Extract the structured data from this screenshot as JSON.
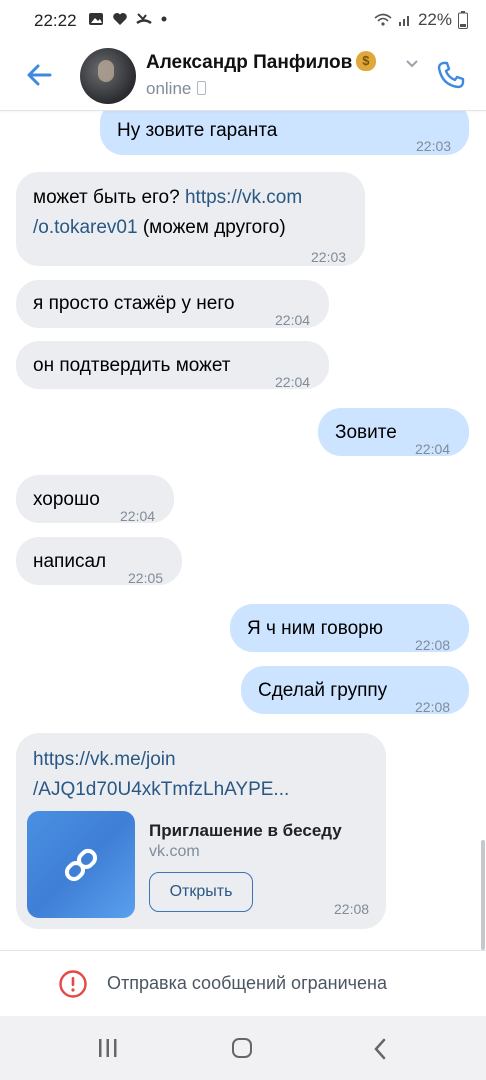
{
  "status_bar": {
    "time": "22:22",
    "battery": "22%"
  },
  "header": {
    "name": "Александр Панфилов",
    "status": "online"
  },
  "messages": [
    {
      "text": "Ну зовите гаранта",
      "time": "22:03"
    },
    {
      "text_prefix": "может быть его? ",
      "link": "https://vk.com/o.tokarev01",
      "link_line1": "https://vk.com",
      "link_line2": "/o.tokarev01",
      "text_suffix": " (можем другого)",
      "time": "22:03"
    },
    {
      "text": "я просто стажёр у него",
      "time": "22:04"
    },
    {
      "text": "он подтвердить может",
      "time": "22:04"
    },
    {
      "text": "Зовите",
      "time": "22:04"
    },
    {
      "text": "хорошо",
      "time": "22:04"
    },
    {
      "text": "написал",
      "time": "22:05"
    },
    {
      "text": "Я ч ним говорю",
      "time": "22:08"
    },
    {
      "text": "Сделай группу",
      "time": "22:08"
    }
  ],
  "invite": {
    "url_line1": "https://vk.me/join",
    "url_line2": "/AJQ1d70U4xkTmfzLhAYPE...",
    "title": "Приглашение в беседу",
    "site": "vk.com",
    "button": "Открыть",
    "time": "22:08"
  },
  "restriction": {
    "text": "Отправка сообщений ограничена"
  },
  "colors": {
    "accent": "#2a5885",
    "incoming": "#ebedf0",
    "outgoing": "#cce4ff",
    "warning": "#e64646"
  },
  "icons": [
    "back-arrow-icon",
    "phone-icon",
    "chevron-down-icon",
    "link-icon",
    "warning-icon",
    "recent-apps-icon",
    "home-icon",
    "nav-back-icon"
  ]
}
